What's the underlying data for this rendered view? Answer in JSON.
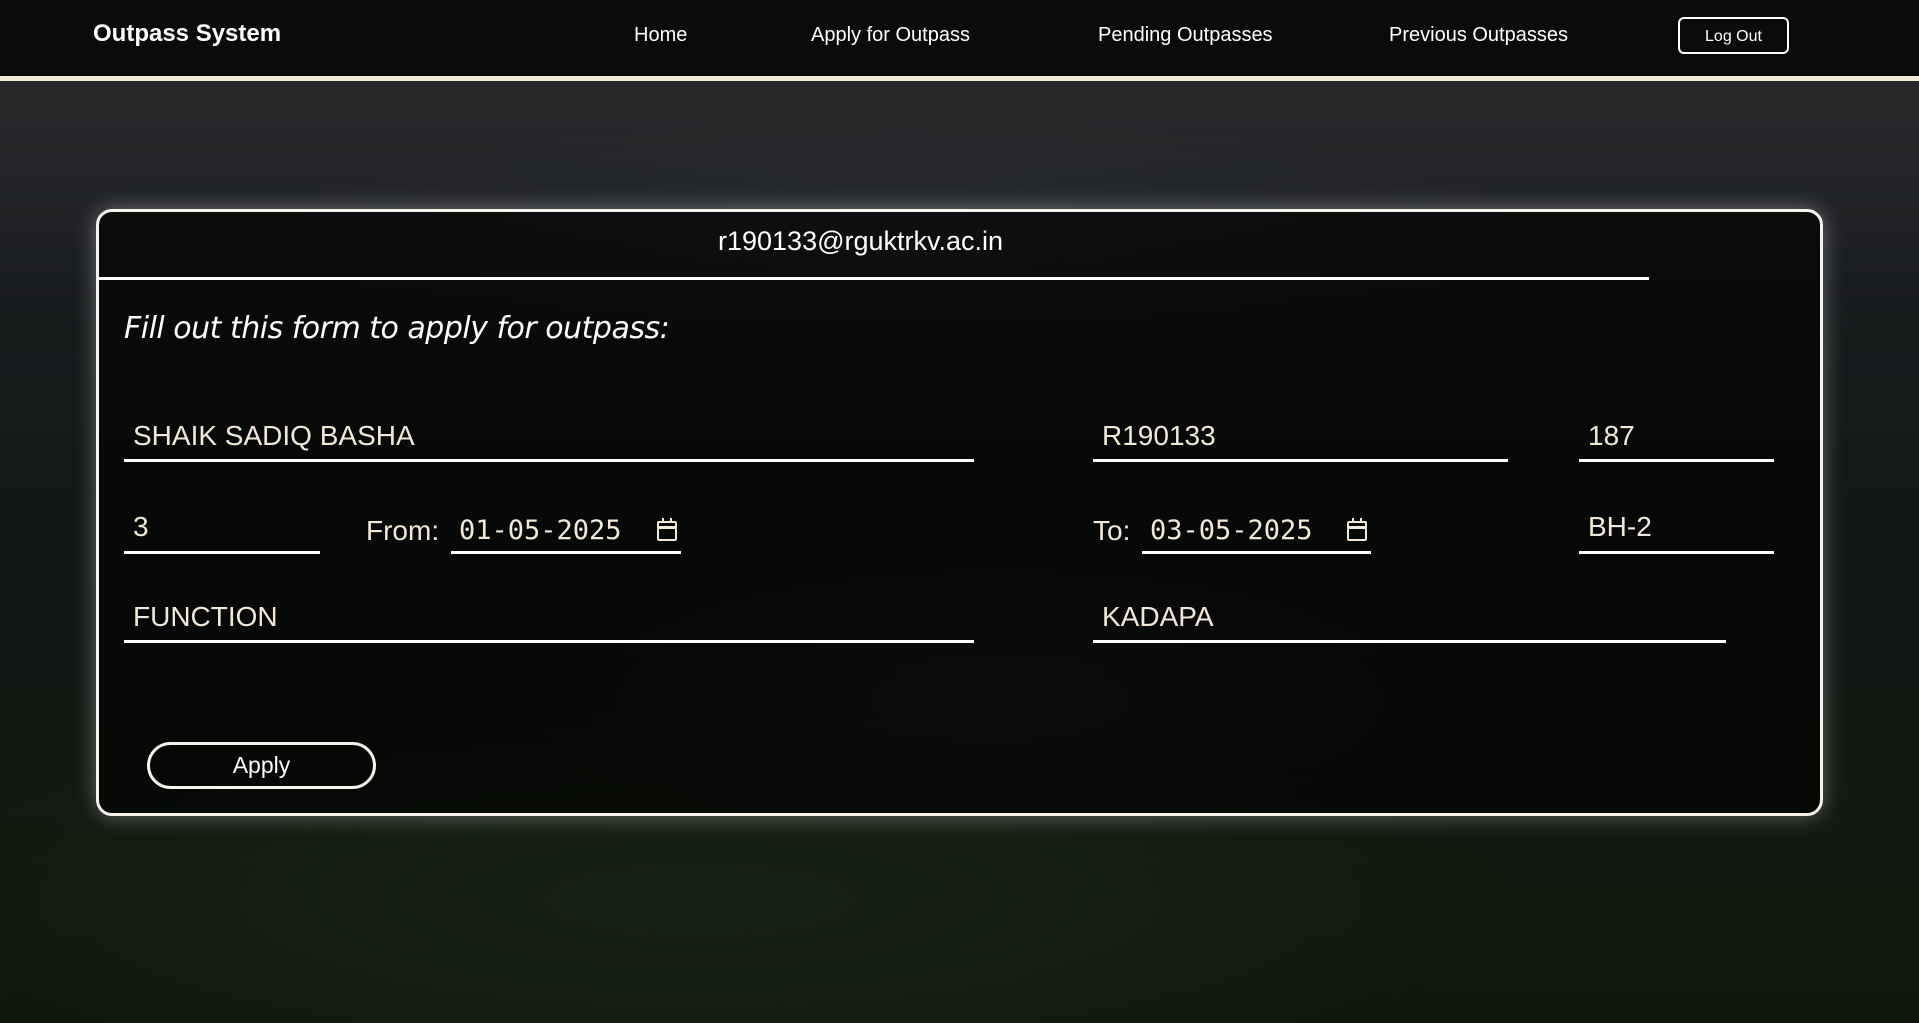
{
  "nav": {
    "brand": "Outpass System",
    "links": [
      "Home",
      "Apply for Outpass",
      "Pending Outpasses",
      "Previous Outpasses"
    ],
    "logout_label": "Log Out"
  },
  "form": {
    "email": "r190133@rguktrkv.ac.in",
    "instructions": "Fill out this form to apply for outpass:",
    "name": "SHAIK SADIQ BASHA",
    "id_number": "R190133",
    "room": "187",
    "year": "3",
    "from_label": "From:",
    "from_date": "01-05-2025",
    "to_label": "To:",
    "to_date": "03-05-2025",
    "hostel": "BH-2",
    "reason": "FUNCTION",
    "destination": "KADAPA",
    "apply_label": "Apply"
  }
}
